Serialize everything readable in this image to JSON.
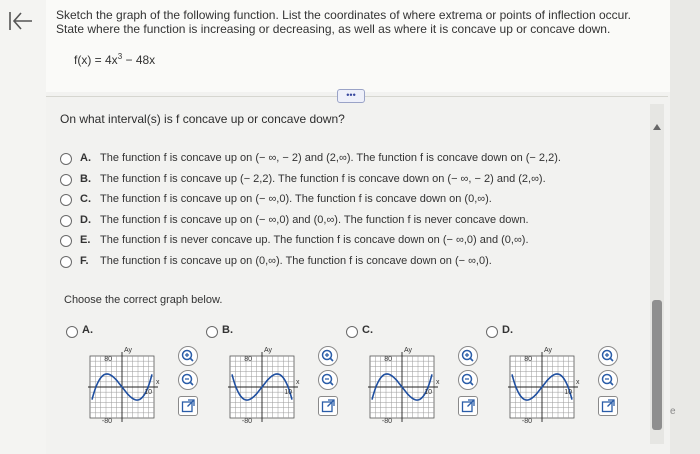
{
  "header": {
    "prompt": "Sketch the graph of the following function. List the coordinates of where extrema or points of inflection occur. State where the function is increasing or decreasing, as well as where it is concave up or concave down.",
    "function_prefix": "f(x) = 4x",
    "function_exponent": "3",
    "function_suffix": " − 48x",
    "more_label": "•••"
  },
  "question": "On what interval(s) is f concave up or concave down?",
  "options": [
    {
      "letter": "A.",
      "text": "The function f is concave up on (− ∞, − 2) and (2,∞). The function f is concave down on (− 2,2)."
    },
    {
      "letter": "B.",
      "text": "The function f is concave up (− 2,2). The function f is concave down on (− ∞, − 2) and (2,∞)."
    },
    {
      "letter": "C.",
      "text": "The function f is concave up on (− ∞,0). The function f is concave down on (0,∞)."
    },
    {
      "letter": "D.",
      "text": "The function f is concave up on (− ∞,0) and (0,∞). The function f is never concave down."
    },
    {
      "letter": "E.",
      "text": "The function f is never concave up. The function f is concave down on (− ∞,0) and (0,∞)."
    },
    {
      "letter": "F.",
      "text": "The function f is concave up on (0,∞). The function f is concave down on (− ∞,0)."
    }
  ],
  "choose_label": "Choose the correct graph below.",
  "graphs": [
    {
      "letter": "A.",
      "ytop": "80",
      "ybot": "-80",
      "xr": "10",
      "xl": "x",
      "yl": "Ay"
    },
    {
      "letter": "B.",
      "ytop": "80",
      "ybot": "-80",
      "xr": "10",
      "xl": "x",
      "yl": "Ay"
    },
    {
      "letter": "C.",
      "ytop": "80",
      "ybot": "-80",
      "xr": "10",
      "xl": "x",
      "yl": "Ay"
    },
    {
      "letter": "D.",
      "ytop": "80",
      "ybot": "-80",
      "xr": "10",
      "xl": "x",
      "yl": "Ay"
    }
  ],
  "edge_text": "e",
  "icons": {
    "back": "back-arrow-icon",
    "zoom_in": "zoom-in-icon",
    "zoom_out": "zoom-out-icon",
    "popout": "popout-icon"
  }
}
